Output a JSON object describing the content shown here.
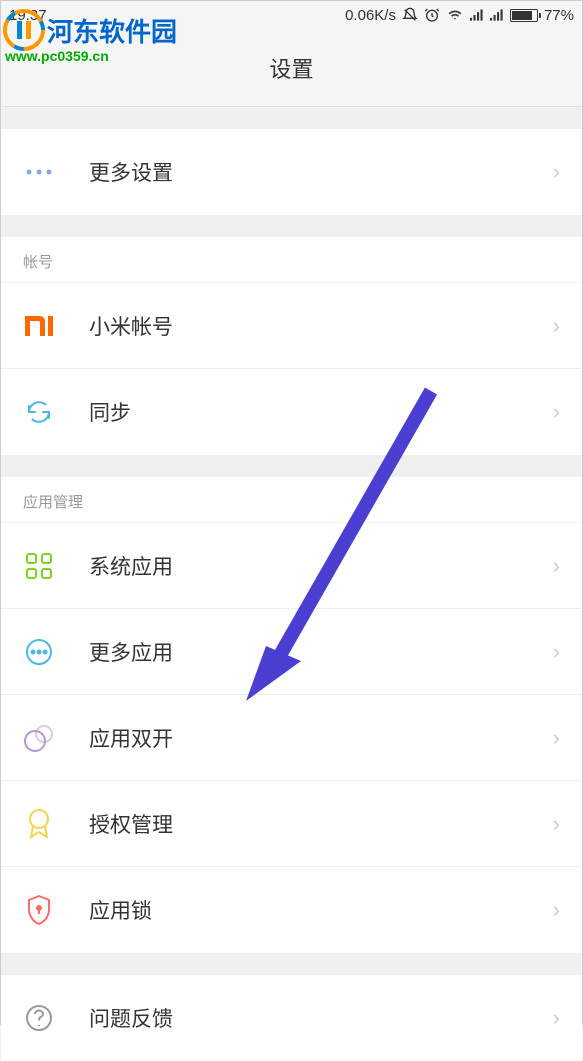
{
  "status_bar": {
    "time": "19:37",
    "net_speed": "0.06K/s",
    "battery_percent": "77%"
  },
  "watermark": {
    "brand": "河东软件园",
    "url": "www.pc0359.cn"
  },
  "header": {
    "title": "设置"
  },
  "sections": {
    "top": {
      "items": [
        {
          "label": "更多设置"
        }
      ]
    },
    "account": {
      "header": "帐号",
      "items": [
        {
          "label": "小米帐号"
        },
        {
          "label": "同步"
        }
      ]
    },
    "app_manage": {
      "header": "应用管理",
      "items": [
        {
          "label": "系统应用"
        },
        {
          "label": "更多应用"
        },
        {
          "label": "应用双开"
        },
        {
          "label": "授权管理"
        },
        {
          "label": "应用锁"
        }
      ]
    },
    "feedback": {
      "items": [
        {
          "label": "问题反馈"
        }
      ]
    }
  },
  "icons": {
    "mi_color": "#ff6700",
    "sync_color": "#4db8e8",
    "apps_color": "#7ed321",
    "more_apps_color": "#4db8e8",
    "dual_apps_color": "#b794d4",
    "auth_color": "#f5d550",
    "lock_color": "#ff6b6b",
    "help_color": "#999"
  }
}
